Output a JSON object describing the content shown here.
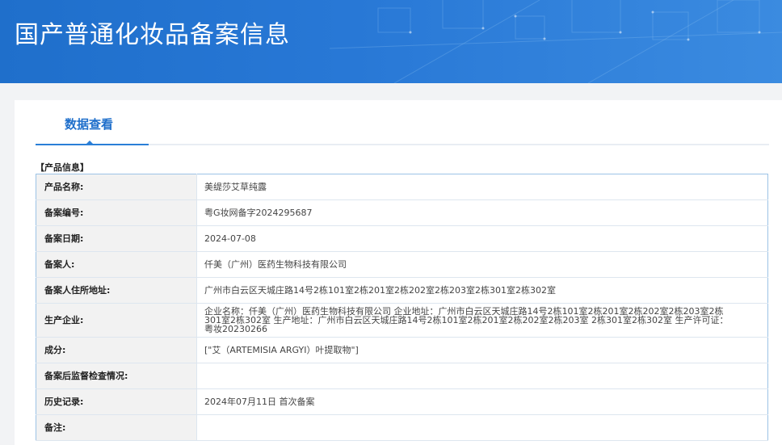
{
  "header": {
    "title": "国产普通化妆品备案信息"
  },
  "tabs": [
    {
      "label": "数据查看",
      "active": true
    }
  ],
  "section": {
    "label": "【产品信息】"
  },
  "rows": [
    {
      "label": "产品名称:",
      "value": "美缇莎艾草纯露"
    },
    {
      "label": "备案编号:",
      "value": "粤G妆网备字2024295687"
    },
    {
      "label": "备案日期:",
      "value": "2024-07-08"
    },
    {
      "label": "备案人:",
      "value": "仟美（广州）医药生物科技有限公司"
    },
    {
      "label": "备案人住所地址:",
      "value": "广州市白云区天城庄路14号2栋101室2栋201室2栋202室2栋203室2栋301室2栋302室"
    },
    {
      "label": "生产企业:",
      "value": "企业名称：仟美（广州）医药生物科技有限公司 企业地址：广州市白云区天城庄路14号2栋101室2栋201室2栋202室2栋203室2栋301室2栋302室 生产地址：广州市白云区天城庄路14号2栋101室2栋201室2栋202室2栋203室 2栋301室2栋302室 生产许可证：粤妆20230266"
    },
    {
      "label": "成分:",
      "value": "[\"艾（ARTEMISIA ARGYI）叶提取物\"]"
    },
    {
      "label": "备案后监督检查情况:",
      "value": ""
    },
    {
      "label": "历史记录:",
      "value": "2024年07月11日 首次备案"
    },
    {
      "label": "备注:",
      "value": ""
    }
  ],
  "colors": {
    "banner": "#2878d6",
    "accent": "#1f6fcb",
    "table_border": "#9cc3e6",
    "key_bg": "#f2f2f2"
  }
}
